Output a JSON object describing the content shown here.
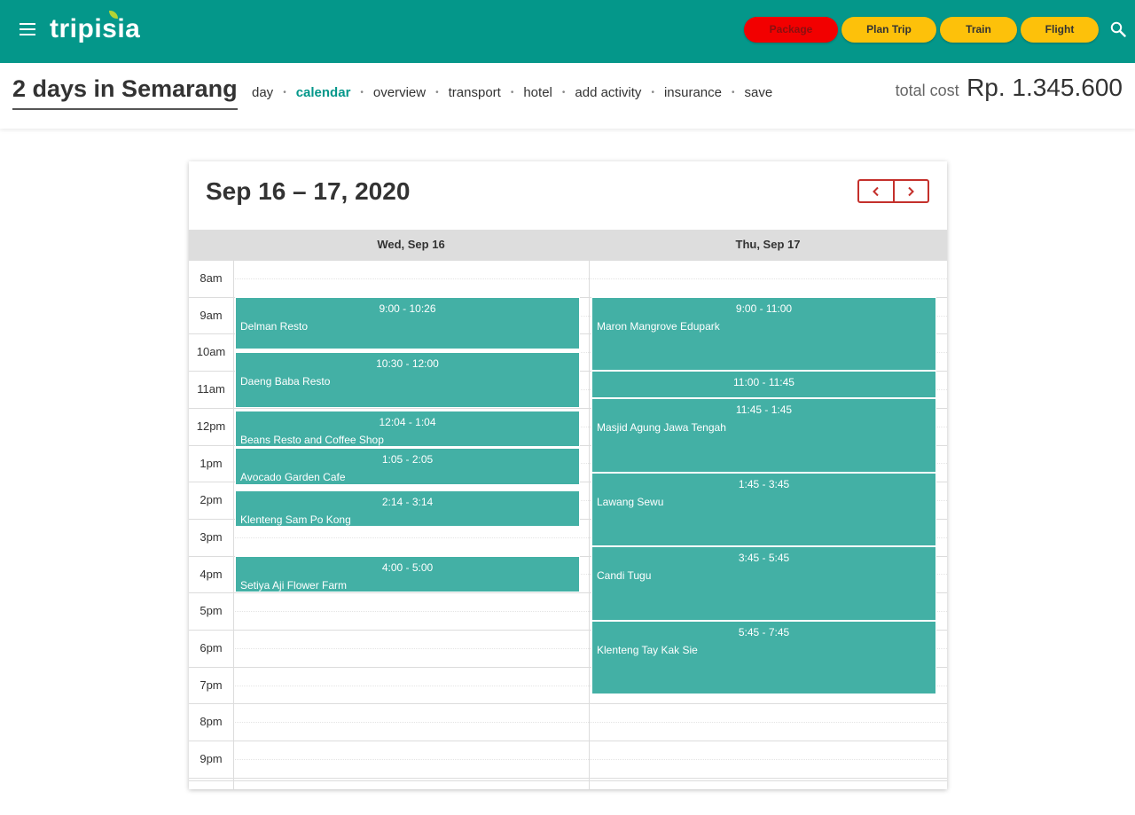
{
  "brand": {
    "name": "tripisia"
  },
  "header_buttons": {
    "package": "Package",
    "plan_trip": "Plan Trip",
    "train": "Train",
    "flight": "Flight"
  },
  "trip": {
    "title": "2 days in Semarang",
    "tabs": [
      "day",
      "calendar",
      "overview",
      "transport",
      "hotel",
      "add activity",
      "insurance",
      "save"
    ],
    "active_tab": "calendar",
    "total_cost_label": "total cost",
    "total_cost_value": "Rp. 1.345.600"
  },
  "calendar": {
    "title": "Sep 16 – 17, 2020",
    "columns": [
      "Wed, Sep 16",
      "Thu, Sep 17"
    ],
    "hours": [
      "8am",
      "9am",
      "10am",
      "11am",
      "12pm",
      "1pm",
      "2pm",
      "3pm",
      "4pm",
      "5pm",
      "6pm",
      "7pm",
      "8pm",
      "9pm"
    ],
    "events": [
      {
        "day": 0,
        "time": "9:00 - 10:26",
        "title": "Delman Resto",
        "start": 9.0,
        "end": 10.43
      },
      {
        "day": 0,
        "time": "10:30 - 12:00",
        "title": "Daeng Baba Resto",
        "start": 10.5,
        "end": 12.0
      },
      {
        "day": 0,
        "time": "12:04 - 1:04",
        "title": "Beans Resto and Coffee Shop",
        "start": 12.07,
        "end": 13.07
      },
      {
        "day": 0,
        "time": "1:05 - 2:05",
        "title": "Avocado Garden Cafe",
        "start": 13.08,
        "end": 14.08
      },
      {
        "day": 0,
        "time": "2:14 - 3:14",
        "title": "Klenteng Sam Po Kong",
        "start": 14.23,
        "end": 15.23
      },
      {
        "day": 0,
        "time": "4:00 - 5:00",
        "title": "Setiya Aji Flower Farm",
        "start": 16.0,
        "end": 17.0
      },
      {
        "day": 1,
        "time": "9:00 - 11:00",
        "title": "Maron Mangrove Edupark",
        "start": 9.0,
        "end": 11.0
      },
      {
        "day": 1,
        "time": "11:00 - 11:45",
        "title": "",
        "start": 11.0,
        "end": 11.75
      },
      {
        "day": 1,
        "time": "11:45 - 1:45",
        "title": "Masjid Agung Jawa Tengah",
        "start": 11.75,
        "end": 13.75
      },
      {
        "day": 1,
        "time": "1:45 - 3:45",
        "title": "Lawang Sewu",
        "start": 13.75,
        "end": 15.75
      },
      {
        "day": 1,
        "time": "3:45 - 5:45",
        "title": "Candi Tugu",
        "start": 15.75,
        "end": 17.75
      },
      {
        "day": 1,
        "time": "5:45 - 7:45",
        "title": "Klenteng Tay Kak Sie",
        "start": 17.75,
        "end": 19.75
      }
    ]
  },
  "colors": {
    "brand": "#04978a",
    "event": "#43b0a5",
    "package_button": "#f20000",
    "yellow_button": "#fdc10a",
    "nav_border": "#c4302b"
  },
  "icons": [
    "menu-icon",
    "search-icon",
    "chevron-left-icon",
    "chevron-right-icon"
  ]
}
